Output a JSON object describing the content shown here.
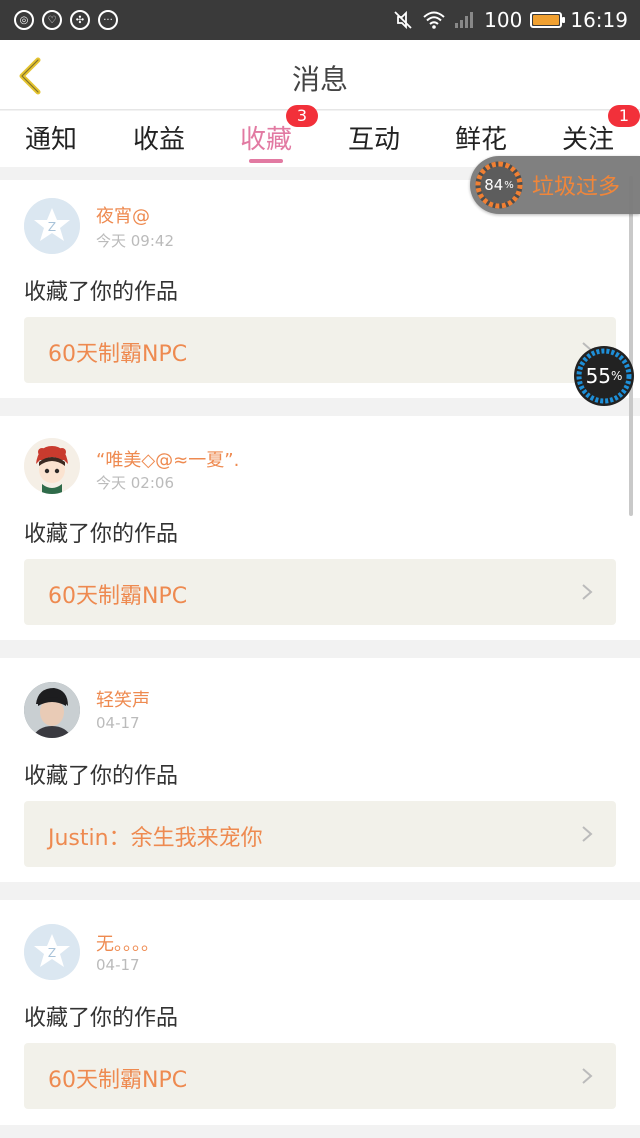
{
  "status_bar": {
    "battery": "100",
    "time": "16:19",
    "battery_level": 1.0
  },
  "header": {
    "title": "消息",
    "back_icon": "chevron-left-icon"
  },
  "tabs": [
    {
      "label": "通知"
    },
    {
      "label": "收益"
    },
    {
      "label": "收藏",
      "badge": "3",
      "active": true
    },
    {
      "label": "互动"
    },
    {
      "label": "鲜花"
    },
    {
      "label": "关注",
      "badge": "1"
    }
  ],
  "messages": [
    {
      "user": "夜宵@",
      "time": "今天 09:42",
      "action": "收藏了你的作品",
      "work": "60天制霸NPC",
      "avatar": "default-avatar"
    },
    {
      "user": "“唯美◇@≈一夏”.",
      "time": "今天 02:06",
      "action": "收藏了你的作品",
      "work": "60天制霸NPC",
      "avatar": "anime-girl-avatar"
    },
    {
      "user": "轻笑声",
      "time": "04-17",
      "action": "收藏了你的作品",
      "work": "Justin：余生我来宠你",
      "avatar": "photo-avatar"
    },
    {
      "user": "无。。。。",
      "time": "04-17",
      "action": "收藏了你的作品",
      "work": "60天制霸NPC",
      "avatar": "default-avatar"
    }
  ],
  "junk_widget": {
    "percent": "84",
    "percent_sign": "%",
    "label": "垃圾过多"
  },
  "memory_widget": {
    "percent": "55",
    "percent_sign": "%"
  },
  "colors": {
    "accent": "#e27aa2",
    "orange": "#ee8a50",
    "badge": "#f2303a",
    "status_bar": "#3a3a3a"
  }
}
